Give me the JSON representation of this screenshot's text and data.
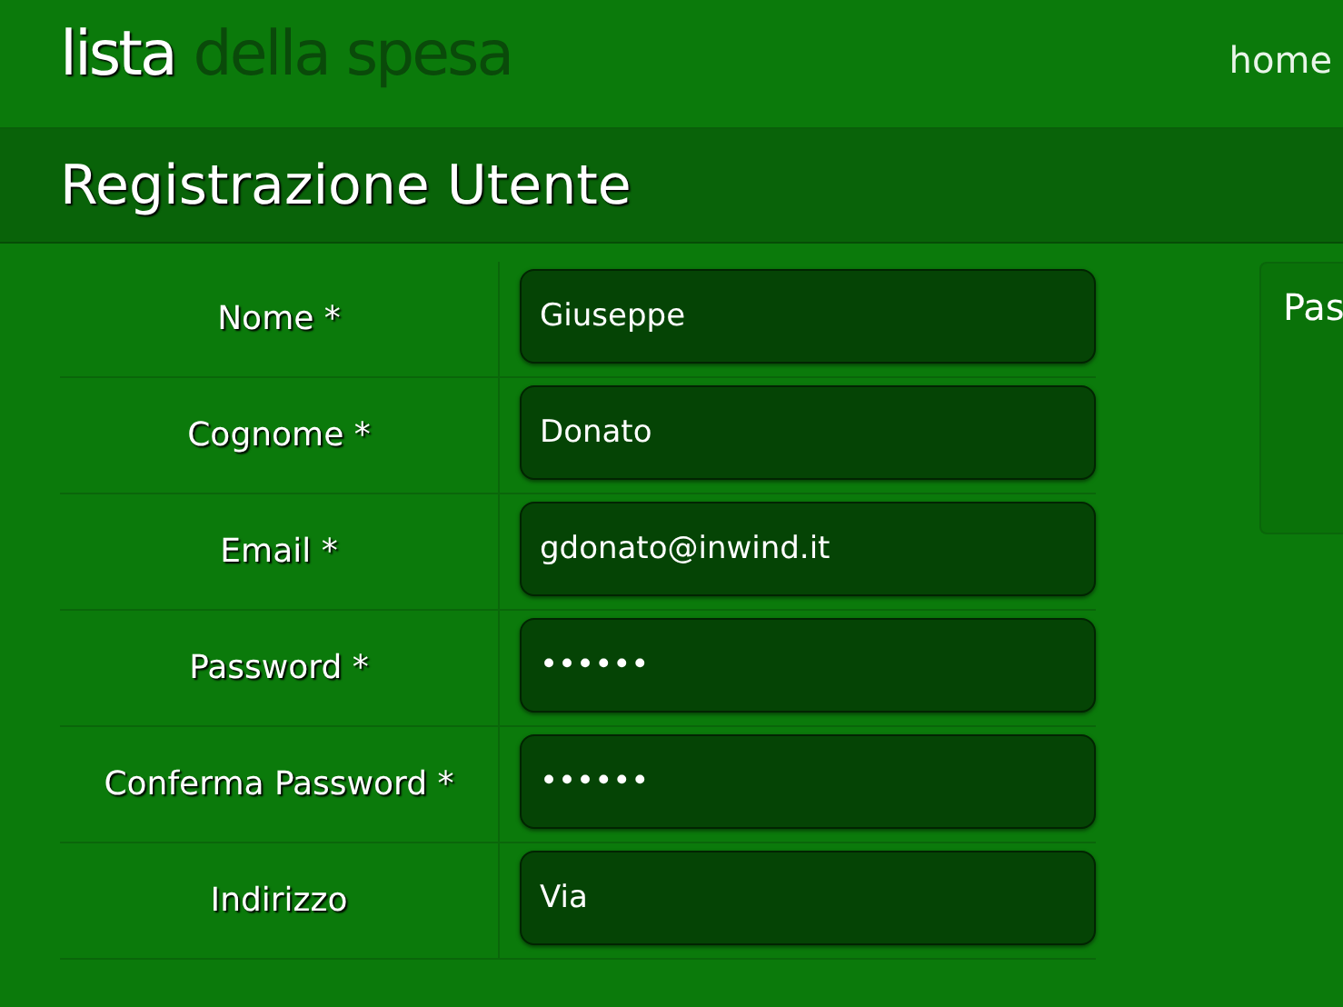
{
  "header": {
    "logo_light": "lista",
    "logo_dark": "della spesa",
    "nav": [
      "home"
    ]
  },
  "page_title": "Registrazione Utente",
  "form": {
    "fields": [
      {
        "label": "Nome *",
        "value": "Giuseppe"
      },
      {
        "label": "Cognome *",
        "value": "Donato"
      },
      {
        "label": "Email *",
        "value": "gdonato@inwind.it"
      },
      {
        "label": "Password *",
        "value": "••••••"
      },
      {
        "label": "Conferma Password *",
        "value": "••••••"
      },
      {
        "label": "Indirizzo",
        "value": "Via "
      }
    ]
  },
  "side_panel": {
    "text": "Pas"
  }
}
